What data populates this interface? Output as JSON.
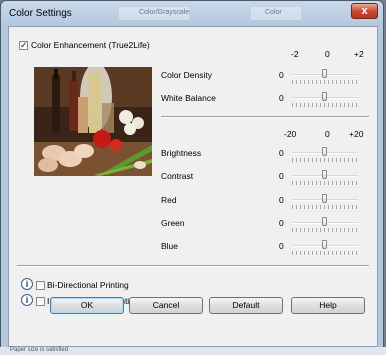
{
  "window": {
    "title": "Color Settings",
    "close_glyph": "x"
  },
  "background_hints": [
    "Color/Grayscale",
    "Color"
  ],
  "color_enhancement": {
    "label": "Color Enhancement (True2Life)",
    "checked": true
  },
  "scale_top": {
    "min": "-2",
    "mid": "0",
    "max": "+2"
  },
  "scale_bottom": {
    "min": "-20",
    "mid": "0",
    "max": "+20"
  },
  "sliders_top": [
    {
      "label": "Color Density",
      "value": "0"
    },
    {
      "label": "White Balance",
      "value": "0"
    }
  ],
  "sliders_bottom": [
    {
      "label": "Brightness",
      "value": "0"
    },
    {
      "label": "Contrast",
      "value": "0"
    },
    {
      "label": "Red",
      "value": "0"
    },
    {
      "label": "Green",
      "value": "0"
    },
    {
      "label": "Blue",
      "value": "0"
    }
  ],
  "options": [
    {
      "label": "Bi-Directional Printing",
      "checked": false
    },
    {
      "label": "Improve Pattern Printing",
      "checked": false
    }
  ],
  "buttons": {
    "ok": "OK",
    "cancel": "Cancel",
    "default": "Default",
    "help": "Help"
  },
  "status_text": "Paper size is satisfied",
  "colors": {
    "title_gradient": "#c9d9ea",
    "close": "#c7452f",
    "client": "#f0f0f0"
  },
  "icons": {
    "info": "info-icon",
    "photo": "sample-photo"
  }
}
